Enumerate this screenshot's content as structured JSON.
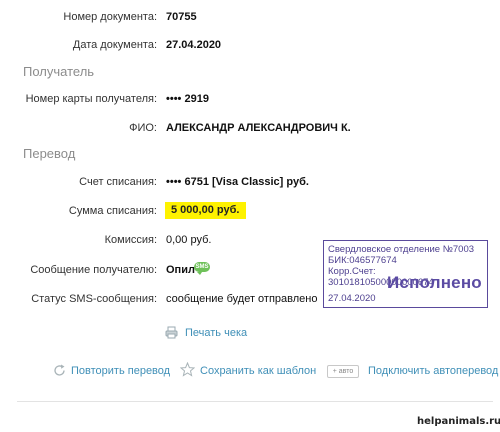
{
  "document": {
    "number_label": "Номер документа:",
    "number_value": "70755",
    "date_label": "Дата документа:",
    "date_value": "27.04.2020"
  },
  "recipient": {
    "section_title": "Получатель",
    "card_label": "Номер карты получателя:",
    "card_value": "•••• 2919",
    "fio_label": "ФИО:",
    "fio_value": "АЛЕКСАНДР АЛЕКСАНДРОВИЧ К."
  },
  "transfer": {
    "section_title": "Перевод",
    "account_label": "Счет списания:",
    "account_value": "•••• 6751  [Visa Classic]  руб.",
    "amount_label": "Сумма списания:",
    "amount_value": "5 000,00  руб.",
    "commission_label": "Комиссия:",
    "commission_value": "0,00 руб.",
    "message_label": "Сообщение получателю:",
    "message_value": "Опил",
    "message_badge": "SMS",
    "sms_status_label": "Статус SMS-сообщения:",
    "sms_status_value": "сообщение будет отправлено"
  },
  "stamp": {
    "line1": "Свердловское отделение №7003",
    "line2": "БИК:046577674",
    "line3": "Корр.Счет: 30101810500000000674",
    "status": "Исполнено",
    "date": "27.04.2020",
    "color": "#5b4ba3"
  },
  "actions": {
    "print_label": "Печать чека",
    "repeat_label": "Повторить перевод",
    "save_template_label": "Сохранить как шаблон",
    "auto_badge": "+ авто",
    "autotransfer_label": "Подключить автоперевод"
  },
  "watermark": "helpanimals.ru",
  "colors": {
    "link": "#3f8fb7",
    "highlight": "#fef200",
    "section": "#8c8c8c",
    "sms_badge": "#6fc15a"
  },
  "icons": {
    "print": "printer-icon",
    "repeat": "refresh-icon",
    "template": "star-icon"
  }
}
